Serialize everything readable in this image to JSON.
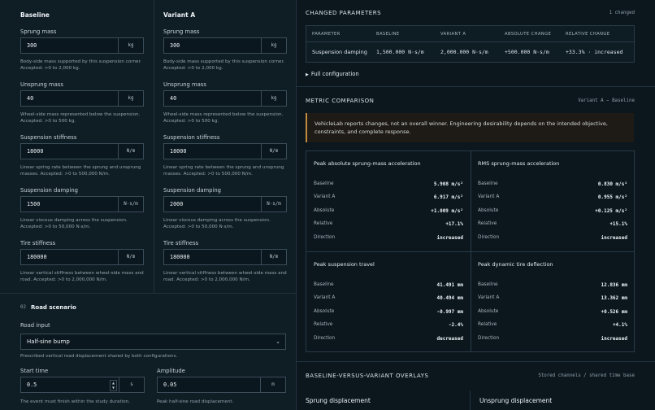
{
  "columns": {
    "baseline": {
      "title": "Baseline",
      "fields": [
        {
          "label": "Sprung mass",
          "value": "300",
          "unit": "kg",
          "help": "Body-side mass supported by this suspension corner. Accepted: >0 to 2,000 kg."
        },
        {
          "label": "Unsprung mass",
          "value": "40",
          "unit": "kg",
          "help": "Wheel-side mass represented below the suspension. Accepted: >0 to 500 kg."
        },
        {
          "label": "Suspension stiffness",
          "value": "18000",
          "unit": "N/m",
          "help": "Linear spring rate between the sprung and unsprung masses. Accepted: >0 to 500,000 N/m."
        },
        {
          "label": "Suspension damping",
          "value": "1500",
          "unit": "N·s/m",
          "help": "Linear viscous damping across the suspension. Accepted: >0 to 50,000 N·s/m."
        },
        {
          "label": "Tire stiffness",
          "value": "180000",
          "unit": "N/m",
          "help": "Linear vertical stiffness between wheel-side mass and road. Accepted: >0 to 2,000,000 N/m."
        }
      ]
    },
    "variant": {
      "title": "Variant A",
      "fields": [
        {
          "label": "Sprung mass",
          "value": "300",
          "unit": "kg",
          "help": "Body-side mass supported by this suspension corner. Accepted: >0 to 2,000 kg."
        },
        {
          "label": "Unsprung mass",
          "value": "40",
          "unit": "kg",
          "help": "Wheel-side mass represented below the suspension. Accepted: >0 to 500 kg."
        },
        {
          "label": "Suspension stiffness",
          "value": "18000",
          "unit": "N/m",
          "help": "Linear spring rate between the sprung and unsprung masses. Accepted: >0 to 500,000 N/m."
        },
        {
          "label": "Suspension damping",
          "value": "2000",
          "unit": "N·s/m",
          "help": "Linear viscous damping across the suspension. Accepted: >0 to 50,000 N·s/m."
        },
        {
          "label": "Tire stiffness",
          "value": "180000",
          "unit": "N/m",
          "help": "Linear vertical stiffness between wheel-side mass and road. Accepted: >0 to 2,000,000 N/m."
        }
      ]
    }
  },
  "road": {
    "num": "02",
    "title": "Road scenario",
    "input_label": "Road input",
    "input_value": "Half-sine bump",
    "input_help": "Prescribed vertical road displacement shared by both configurations.",
    "start_label": "Start time",
    "start_value": "0.5",
    "start_unit": "s",
    "start_help": "The event must finish within the study duration.",
    "amp_label": "Amplitude",
    "amp_value": "0.05",
    "amp_unit": "m",
    "amp_help": "Peak half-sine road displacement."
  },
  "changed": {
    "title": "CHANGED PARAMETERS",
    "count": "1 changed",
    "headers": [
      "PARAMETER",
      "BASELINE",
      "VARIANT A",
      "ABSOLUTE CHANGE",
      "RELATIVE CHANGE"
    ],
    "row": [
      "Suspension damping",
      "1,500.000 N·s/m",
      "2,000.000 N·s/m",
      "+500.000 N·s/m",
      "+33.3% · increased"
    ],
    "full_config": "Full configuration"
  },
  "metric": {
    "title": "METRIC COMPARISON",
    "meta": "Variant A − Baseline",
    "note": "VehicleLab reports changes, not an overall winner. Engineering desirability depends on the intended objective, constraints, and complete response.",
    "cards": [
      {
        "title": "Peak absolute sprung-mass acceleration",
        "rows": [
          [
            "Baseline",
            "5.908 m/s²"
          ],
          [
            "Variant A",
            "6.917 m/s²"
          ],
          [
            "Absolute",
            "+1.009 m/s²"
          ],
          [
            "Relative",
            "+17.1%"
          ],
          [
            "Direction",
            "increased"
          ]
        ]
      },
      {
        "title": "RMS sprung-mass acceleration",
        "rows": [
          [
            "Baseline",
            "0.830 m/s²"
          ],
          [
            "Variant A",
            "0.955 m/s²"
          ],
          [
            "Absolute",
            "+0.125 m/s²"
          ],
          [
            "Relative",
            "+15.1%"
          ],
          [
            "Direction",
            "increased"
          ]
        ]
      },
      {
        "title": "Peak suspension travel",
        "rows": [
          [
            "Baseline",
            "41.491 mm"
          ],
          [
            "Variant A",
            "40.494 mm"
          ],
          [
            "Absolute",
            "-0.997 mm"
          ],
          [
            "Relative",
            "-2.4%"
          ],
          [
            "Direction",
            "decreased"
          ]
        ]
      },
      {
        "title": "Peak dynamic tire deflection",
        "rows": [
          [
            "Baseline",
            "12.836 mm"
          ],
          [
            "Variant A",
            "13.362 mm"
          ],
          [
            "Absolute",
            "+0.526 mm"
          ],
          [
            "Relative",
            "+4.1%"
          ],
          [
            "Direction",
            "increased"
          ]
        ]
      }
    ]
  },
  "overlays": {
    "title": "BASELINE-VERSUS-VARIANT OVERLAYS",
    "meta": "Stored channels / shared time base",
    "left_title": "Sprung displacement",
    "right_title": "Unsprung displacement"
  }
}
